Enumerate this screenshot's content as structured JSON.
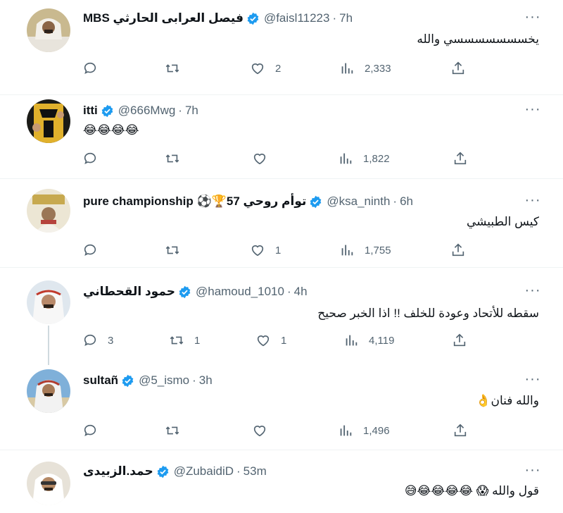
{
  "tweets": [
    {
      "name": "MBS فيصل العرابى الحارثي",
      "handle": "@faisl11223",
      "time": "7h",
      "text": "يخسسسسسسسي والله",
      "replies": "",
      "retweets": "",
      "likes": "2",
      "views": "2,333"
    },
    {
      "name": "itti",
      "handle": "@666Mwg",
      "time": "7h",
      "text": "😂😂😂😂",
      "replies": "",
      "retweets": "",
      "likes": "",
      "views": "1,822"
    },
    {
      "name": "pure championship ⚽🏆توأم روحي 57",
      "handle": "@ksa_ninth",
      "time": "6h",
      "text": "كيس الطبيشي",
      "replies": "",
      "retweets": "",
      "likes": "1",
      "views": "1,755"
    },
    {
      "name": "حمود القحطاني",
      "handle": "@hamoud_1010",
      "time": "4h",
      "text": "سقطه للأتحاد وعودة للخلف !! اذا الخبر صحيح",
      "replies": "3",
      "retweets": "1",
      "likes": "1",
      "views": "4,119"
    },
    {
      "name": "sultañ",
      "handle": "@5_ismo",
      "time": "3h",
      "text": "والله فنان👌",
      "replies": "",
      "retweets": "",
      "likes": "",
      "views": "1,496"
    },
    {
      "name": "حمد.الزبيدى",
      "handle": "@ZubaidiD",
      "time": "53m",
      "text": "قول والله 😱 😂😂😂😂😅",
      "replies": "",
      "retweets": "",
      "likes": "",
      "views": ""
    }
  ],
  "colors": {
    "verified": "#1d9bf0",
    "secondary_text": "#536471",
    "divider": "#eff3f4",
    "thread_line": "#cfd9de"
  },
  "icons": {
    "reply": "reply-icon",
    "retweet": "retweet-icon",
    "like": "heart-icon",
    "views": "views-icon",
    "share": "share-icon",
    "more": "more-icon",
    "verified": "verified-badge-icon"
  }
}
